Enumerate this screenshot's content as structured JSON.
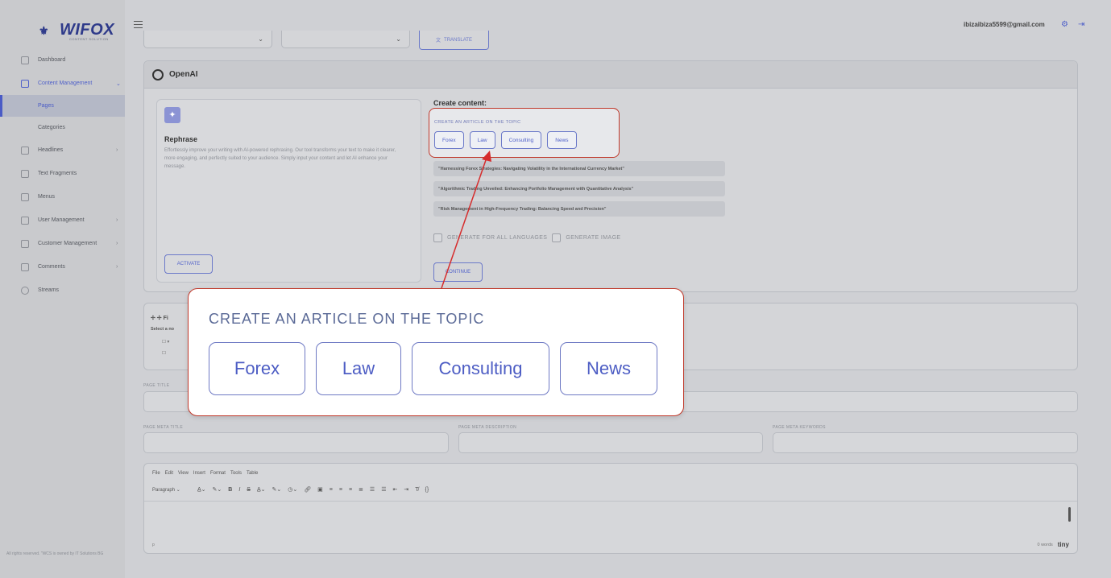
{
  "brand": {
    "name": "WIFOX",
    "tagline": "CONTENT SOLUTION"
  },
  "sidebar": {
    "items": [
      {
        "label": "Dashboard",
        "icon": "dashboard-icon"
      },
      {
        "label": "Content Management",
        "icon": "content-icon",
        "expanded": true
      },
      {
        "label": "Pages",
        "selected": true
      },
      {
        "label": "Categories"
      },
      {
        "label": "Headlines",
        "icon": "headlines-icon"
      },
      {
        "label": "Text Fragments",
        "icon": "text-icon"
      },
      {
        "label": "Menus",
        "icon": "menus-icon"
      },
      {
        "label": "User Management",
        "icon": "users-icon"
      },
      {
        "label": "Customer Management",
        "icon": "customers-icon"
      },
      {
        "label": "Comments",
        "icon": "comments-icon"
      },
      {
        "label": "Streams",
        "icon": "streams-icon"
      }
    ],
    "footer": "All rights reserved. \"WCS is owned by IT Solutions BG"
  },
  "header": {
    "user_email": "ibizaibiza5599@gmail.com"
  },
  "toprow": {
    "translate_label": "TRANSLATE"
  },
  "openai": {
    "title": "OpenAI",
    "rephrase": {
      "title": "Rephrase",
      "description": "Effortlessly improve your writing with AI-powered rephrasing. Our tool transforms your text to make it clearer, more engaging, and perfectly suited to your audience. Simply input your content and let AI enhance your message.",
      "button": "ACTIVATE"
    },
    "create": {
      "title": "Create content:",
      "topic_label": "CREATE AN ARTICLE ON THE TOPIC",
      "topics": [
        "Forex",
        "Law",
        "Consulting",
        "News"
      ],
      "suggestions": [
        "\"Harnessing Forex Strategies: Navigating Volatility in the International Currency Market\"",
        "\"Algorithmic Trading Unveiled: Enhancing Portfolio Management with Quantitative Analysis\"",
        "\"Risk Management in High-Frequency Trading: Balancing Speed and Precision\""
      ],
      "option_all_languages": "GENERATE FOR ALL LANGUAGES",
      "option_image": "GENERATE IMAGE",
      "continue": "CONTINUE"
    }
  },
  "tree_panel": {
    "title": "Fi",
    "subtitle": "Select a no"
  },
  "form": {
    "page_title_label": "PAGE TITLE",
    "meta_title_label": "PAGE META TITLE",
    "meta_description_label": "PAGE META DESCRIPTION",
    "meta_keywords_label": "PAGE META KEYWORDS"
  },
  "editor": {
    "menu": [
      "File",
      "Edit",
      "View",
      "Insert",
      "Format",
      "Tools",
      "Table"
    ],
    "block_format": "Paragraph",
    "status_path": "p",
    "word_count": "0 words",
    "brand": "tiny"
  },
  "zoom": {
    "label": "CREATE AN ARTICLE ON THE TOPIC",
    "topics": [
      "Forex",
      "Law",
      "Consulting",
      "News"
    ]
  },
  "colors": {
    "accent": "#5061c9",
    "highlight": "#c0392b"
  }
}
